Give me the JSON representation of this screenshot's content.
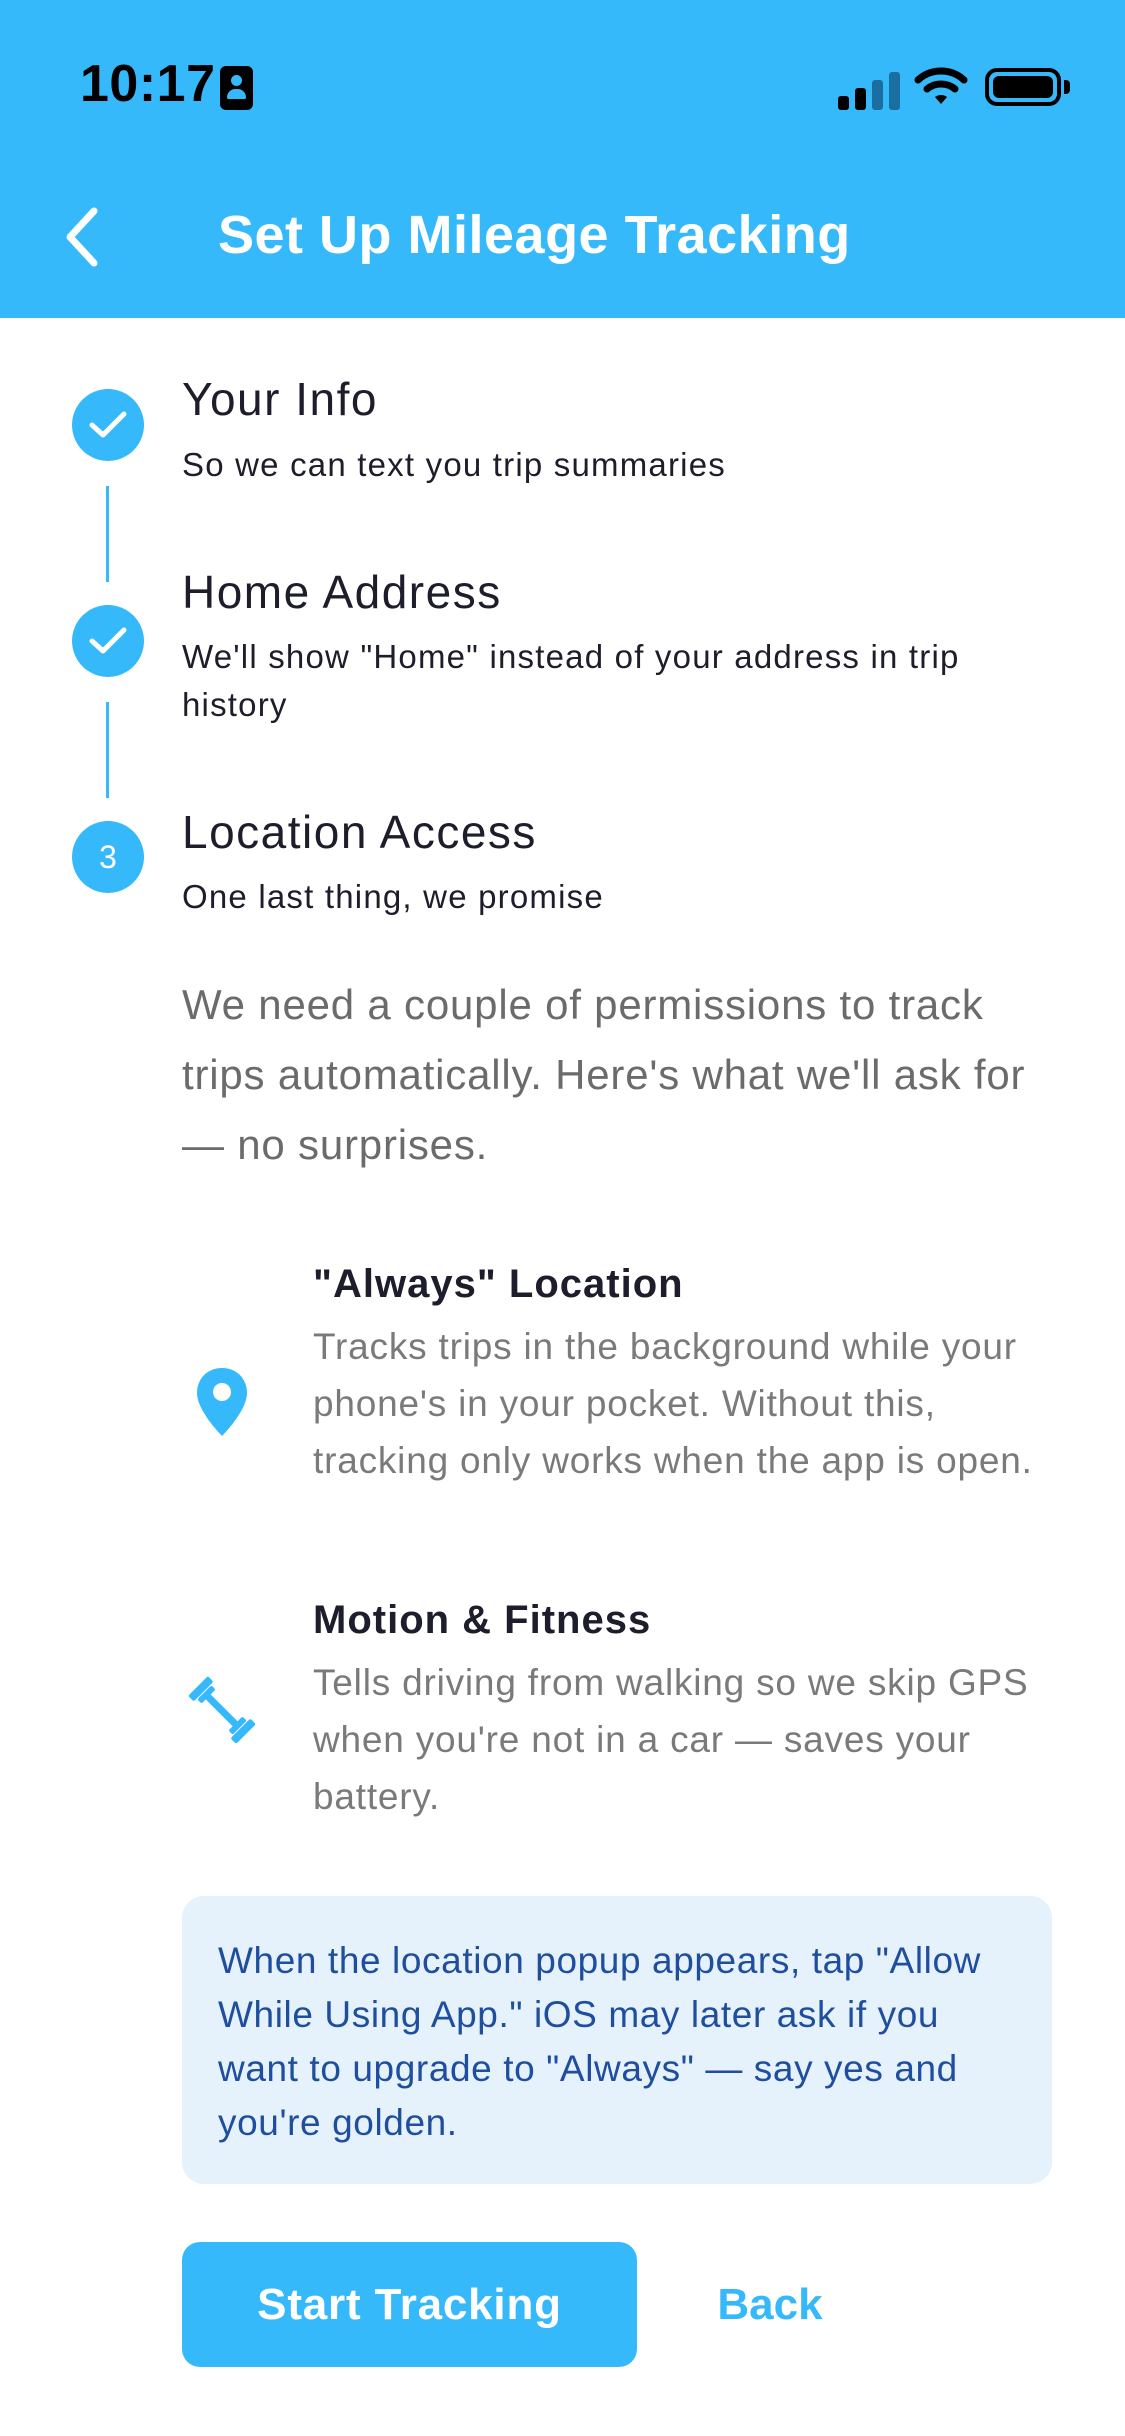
{
  "status_bar": {
    "time": "10:17",
    "icons": [
      "id-badge-icon",
      "cellular-signal-icon",
      "wifi-icon",
      "battery-icon"
    ]
  },
  "header": {
    "title": "Set Up Mileage Tracking",
    "back_icon": "chevron-left-icon",
    "background_color": "#35b9fb"
  },
  "steps": [
    {
      "title": "Your Info",
      "subtitle": "So we can text you trip summaries",
      "status": "completed",
      "icon": "checkmark-icon"
    },
    {
      "title": "Home Address",
      "subtitle": "We'll show \"Home\" instead of your address in trip history",
      "status": "completed",
      "icon": "checkmark-icon"
    },
    {
      "number": "3",
      "title": "Location Access",
      "subtitle": "One last thing, we promise",
      "status": "current"
    }
  ],
  "intro": "We need a couple of permissions to track trips automatically. Here's what we'll ask for — no surprises.",
  "permissions": [
    {
      "icon": "location-pin-icon",
      "title": "\"Always\" Location",
      "description": "Tracks trips in the background while your phone's in your pocket. Without this, tracking only works when the app is open."
    },
    {
      "icon": "dumbbell-icon",
      "title": "Motion & Fitness",
      "description": "Tells driving from walking so we skip GPS when you're not in a car — saves your battery."
    }
  ],
  "note": "When the location popup appears, tap \"Allow While Using App.\" iOS may later ask if you want to upgrade to \"Always\" — say yes and you're golden.",
  "buttons": {
    "primary": "Start Tracking",
    "secondary": "Back"
  },
  "colors": {
    "accent": "#35b9fb",
    "note_background": "#e5f1fb",
    "note_text": "#1f4e9e",
    "muted_text": "#6b6b6b"
  }
}
